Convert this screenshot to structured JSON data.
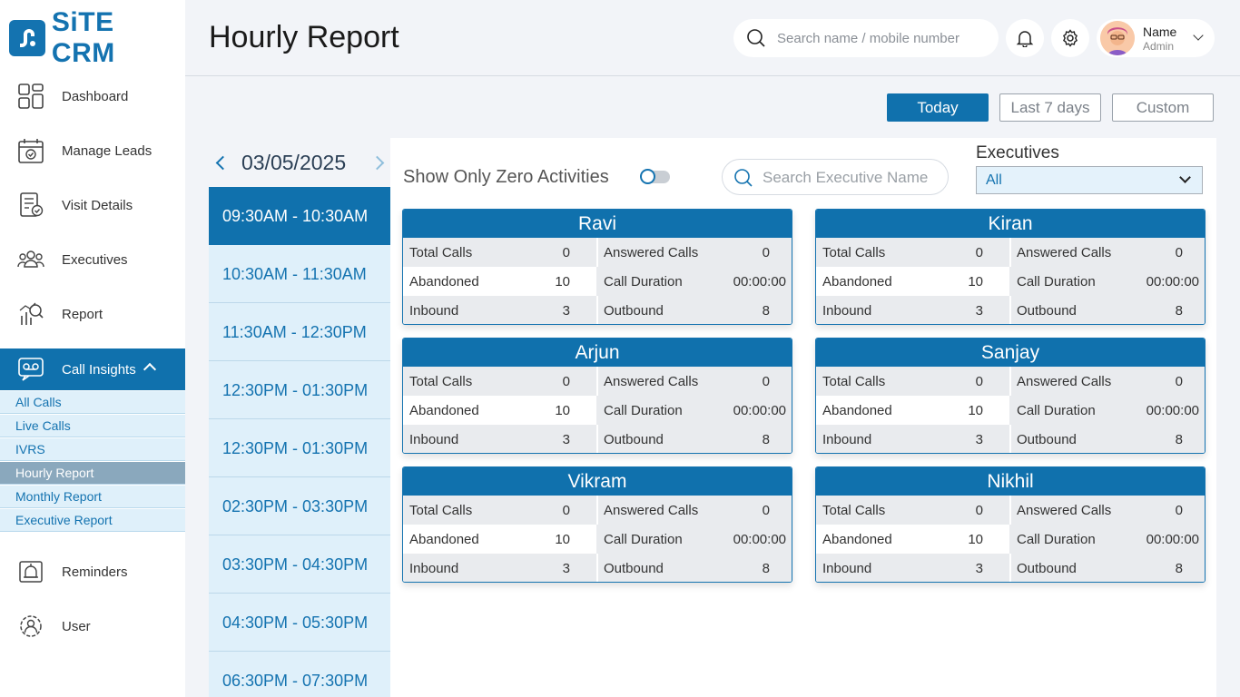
{
  "app": {
    "name": "SiTE CRM",
    "page_title": "Hourly Report"
  },
  "header": {
    "search_placeholder": "Search name / mobile number",
    "profile": {
      "name": "Name",
      "role": "Admin"
    }
  },
  "sidebar": {
    "items": [
      {
        "label": "Dashboard",
        "icon": "dashboard-icon"
      },
      {
        "label": "Manage Leads",
        "icon": "calendar-check-icon"
      },
      {
        "label": "Visit Details",
        "icon": "document-check-icon"
      },
      {
        "label": "Executives",
        "icon": "users-group-icon"
      },
      {
        "label": "Report",
        "icon": "report-chart-icon"
      },
      {
        "label": "Call Insights",
        "icon": "voicemail-chat-icon"
      },
      {
        "label": "Reminders",
        "icon": "alarm-icon"
      },
      {
        "label": "User",
        "icon": "user-gear-icon"
      }
    ],
    "sub_items": [
      "All Calls",
      "Live Calls",
      "IVRS",
      "Hourly Report",
      "Monthly Report",
      "Executive Report"
    ]
  },
  "range_buttons": {
    "today": "Today",
    "last7": "Last 7 days",
    "custom": "Custom"
  },
  "date_panel": {
    "date": "03/05/2025",
    "slots": [
      "09:30AM - 10:30AM",
      "10:30AM - 11:30AM",
      "11:30AM - 12:30PM",
      "12:30PM - 01:30PM",
      "12:30PM - 01:30PM",
      "02:30PM - 03:30PM",
      "03:30PM - 04:30PM",
      "04:30PM - 05:30PM",
      "06:30PM - 07:30PM"
    ]
  },
  "filters": {
    "zero_label": "Show Only Zero Activities",
    "search_placeholder": "Search Executive Name",
    "executives_label": "Executives",
    "executives_value": "All"
  },
  "labels": {
    "total_calls": "Total Calls",
    "answered_calls": "Answered Calls",
    "abandoned": "Abandoned",
    "call_duration": "Call Duration",
    "inbound": "Inbound",
    "outbound": "Outbound"
  },
  "executives": [
    {
      "name": "Ravi",
      "total_calls": "0",
      "answered_calls": "0",
      "abandoned": "10",
      "call_duration": "00:00:00",
      "inbound": "3",
      "outbound": "8"
    },
    {
      "name": "Kiran",
      "total_calls": "0",
      "answered_calls": "0",
      "abandoned": "10",
      "call_duration": "00:00:00",
      "inbound": "3",
      "outbound": "8"
    },
    {
      "name": "Arjun",
      "total_calls": "0",
      "answered_calls": "0",
      "abandoned": "10",
      "call_duration": "00:00:00",
      "inbound": "3",
      "outbound": "8"
    },
    {
      "name": "Sanjay",
      "total_calls": "0",
      "answered_calls": "0",
      "abandoned": "10",
      "call_duration": "00:00:00",
      "inbound": "3",
      "outbound": "8"
    },
    {
      "name": "Vikram",
      "total_calls": "0",
      "answered_calls": "0",
      "abandoned": "10",
      "call_duration": "00:00:00",
      "inbound": "3",
      "outbound": "8"
    },
    {
      "name": "Nikhil",
      "total_calls": "0",
      "answered_calls": "0",
      "abandoned": "10",
      "call_duration": "00:00:00",
      "inbound": "3",
      "outbound": "8"
    }
  ],
  "colors": {
    "primary": "#1071ad",
    "sub_bg": "#dff0fa",
    "selected_sub": "#8aa8bd"
  }
}
